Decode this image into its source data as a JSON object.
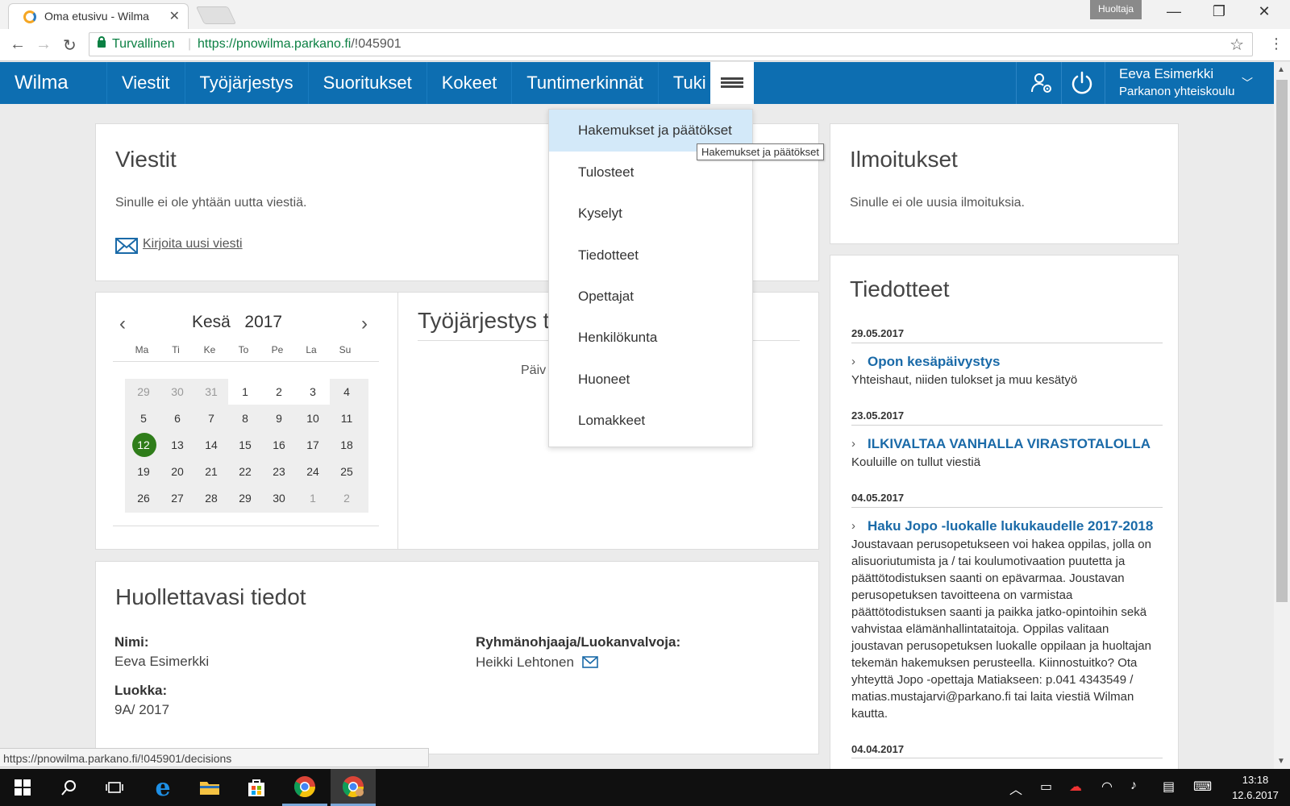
{
  "browser": {
    "tab_title": "Oma etusivu - Wilma",
    "profile_label": "Huoltaja",
    "secure_label": "Turvallinen",
    "url_host": "https://pnowilma.parkano.fi",
    "url_path": "/!045901",
    "status_url": "https://pnowilma.parkano.fi/!045901/decisions"
  },
  "header": {
    "brand": "Wilma",
    "nav": [
      "Viestit",
      "Työjärjestys",
      "Suoritukset",
      "Kokeet",
      "Tuntimerkinnät",
      "Tuki"
    ],
    "user_name": "Eeva Esimerkki",
    "user_school": "Parkanon yhteiskoulu"
  },
  "dropdown": {
    "items": [
      "Hakemukset ja päätökset",
      "Tulosteet",
      "Kyselyt",
      "Tiedotteet",
      "Opettajat",
      "Henkilökunta",
      "Huoneet",
      "Lomakkeet"
    ],
    "tooltip": "Hakemukset ja päätökset"
  },
  "messages": {
    "title": "Viestit",
    "empty_text": "Sinulle ei ole yhtään uutta viestiä.",
    "compose_link": "Kirjoita uusi viesti"
  },
  "calendar": {
    "month": "Kesä",
    "year": "2017",
    "weekdays": [
      "Ma",
      "Ti",
      "Ke",
      "To",
      "Pe",
      "La",
      "Su"
    ],
    "weeks": [
      [
        "29",
        "30",
        "31",
        "1",
        "2",
        "3",
        "4"
      ],
      [
        "5",
        "6",
        "7",
        "8",
        "9",
        "10",
        "11"
      ],
      [
        "12",
        "13",
        "14",
        "15",
        "16",
        "17",
        "18"
      ],
      [
        "19",
        "20",
        "21",
        "22",
        "23",
        "24",
        "25"
      ],
      [
        "26",
        "27",
        "28",
        "29",
        "30",
        "1",
        "2"
      ]
    ],
    "today": "12"
  },
  "schedule": {
    "title_visible": "Työjärjestys tä",
    "body_visible": "Päiv"
  },
  "notifications": {
    "title": "Ilmoitukset",
    "empty_text": "Sinulle ei ole uusia ilmoituksia."
  },
  "bulletins": {
    "title": "Tiedotteet",
    "items": [
      {
        "date": "29.05.2017",
        "title": "Opon kesäpäivystys",
        "text": "Yhteishaut, niiden tulokset ja muu kesätyö"
      },
      {
        "date": "23.05.2017",
        "title": "ILKIVALTAA VANHALLA VIRASTOTALOLLA",
        "text": "Kouluille on tullut viestiä"
      },
      {
        "date": "04.05.2017",
        "title": "Haku Jopo -luokalle lukukaudelle 2017-2018",
        "text": "Joustavaan perusopetukseen voi hakea oppilas, jolla on alisuoriutumista ja / tai koulumotivaation puutetta ja päättötodistuksen saanti on epävarmaa. Joustavan perusopetuksen tavoitteena on varmistaa päättötodistuksen saanti ja paikka jatko-opintoihin sekä vahvistaa elämänhallintataitoja. Oppilas valitaan joustavan perusopetuksen luokalle oppilaan ja huoltajan tekemän hakemuksen perusteella. Kiinnostuitko? Ota yhteyttä Jopo -opettaja Matiakseen: p.041 4343549 / matias.mustajarvi@parkano.fi tai laita viestiä Wilman kautta."
      },
      {
        "date": "04.04.2017",
        "title": "",
        "text": ""
      }
    ]
  },
  "ward": {
    "title": "Huollettavasi tiedot",
    "name_label": "Nimi:",
    "name_value": "Eeva Esimerkki",
    "class_label": "Luokka:",
    "class_value": "9A/ 2017",
    "teacher_label": "Ryhmänohjaaja/Luokanvalvoja:",
    "teacher_value": "Heikki Lehtonen"
  },
  "taskbar": {
    "time": "13:18",
    "date": "12.6.2017"
  },
  "colors": {
    "wilma_blue": "#0d6eb1",
    "link_blue": "#1a6aa8",
    "today_green": "#2f7d1a",
    "secure_green": "#0b8043"
  }
}
